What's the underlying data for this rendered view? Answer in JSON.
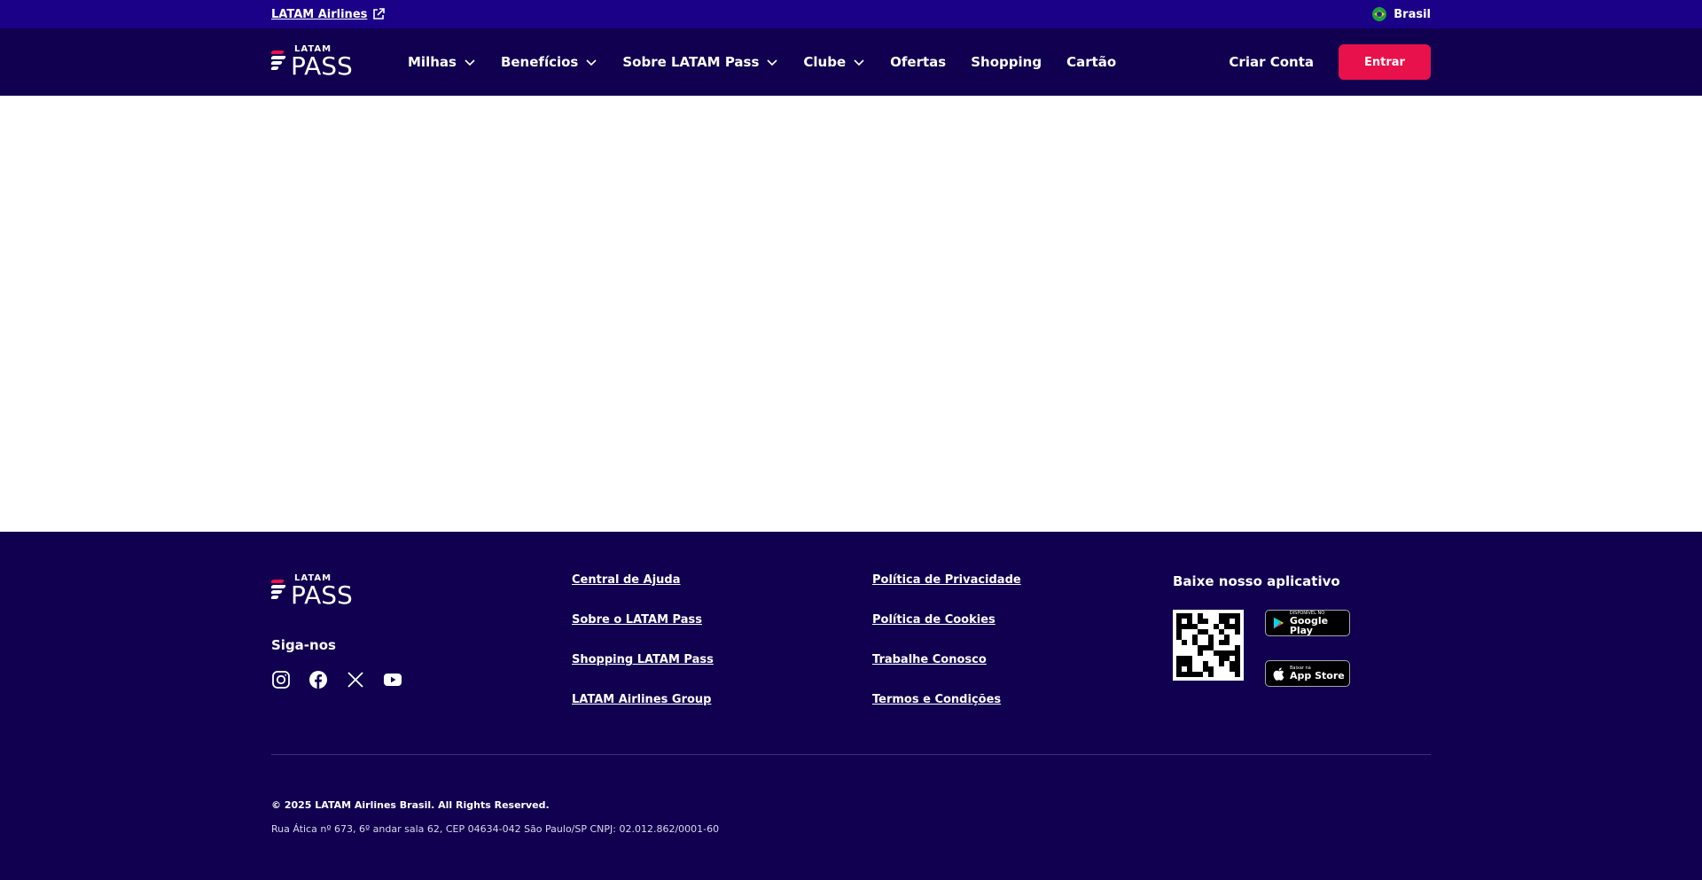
{
  "topbar": {
    "airline_link": "LATAM Airlines",
    "country": "Brasil"
  },
  "nav": {
    "logo_small": "LATAM",
    "logo_big": "PASS",
    "items": [
      {
        "label": "Milhas",
        "dropdown": true
      },
      {
        "label": "Benefícios",
        "dropdown": true
      },
      {
        "label": "Sobre LATAM Pass",
        "dropdown": true
      },
      {
        "label": "Clube",
        "dropdown": true
      },
      {
        "label": "Ofertas",
        "dropdown": false
      },
      {
        "label": "Shopping",
        "dropdown": false
      },
      {
        "label": "Cartão",
        "dropdown": false
      }
    ],
    "create_account": "Criar Conta",
    "login": "Entrar"
  },
  "footer": {
    "logo_small": "LATAM",
    "logo_big": "PASS",
    "follow_label": "Siga-nos",
    "socials": [
      "instagram-icon",
      "facebook-icon",
      "x-icon",
      "youtube-icon"
    ],
    "links_col1": [
      "Central de Ajuda",
      "Sobre o LATAM Pass",
      "Shopping LATAM Pass",
      "LATAM Airlines Group"
    ],
    "links_col2": [
      "Política de Privacidade",
      "Política de Cookies",
      "Trabalhe Conosco",
      "Termos e Condições"
    ],
    "app_title": "Baixe nosso aplicativo",
    "google_play": {
      "small": "DISPONÍVEL NO",
      "big": "Google Play"
    },
    "app_store": {
      "small": "Baixar na",
      "big": "App Store"
    },
    "copyright": "© 2025 LATAM Airlines Brasil. All Rights Reserved.",
    "address": "Rua Ática nº 673, 6º andar sala 62, CEP 04634-042 São Paulo/SP CNPJ: 02.012.862/0001-60"
  },
  "colors": {
    "topbar_bg": "#1b0088",
    "nav_bg": "#10004f",
    "accent": "#e8114b"
  }
}
